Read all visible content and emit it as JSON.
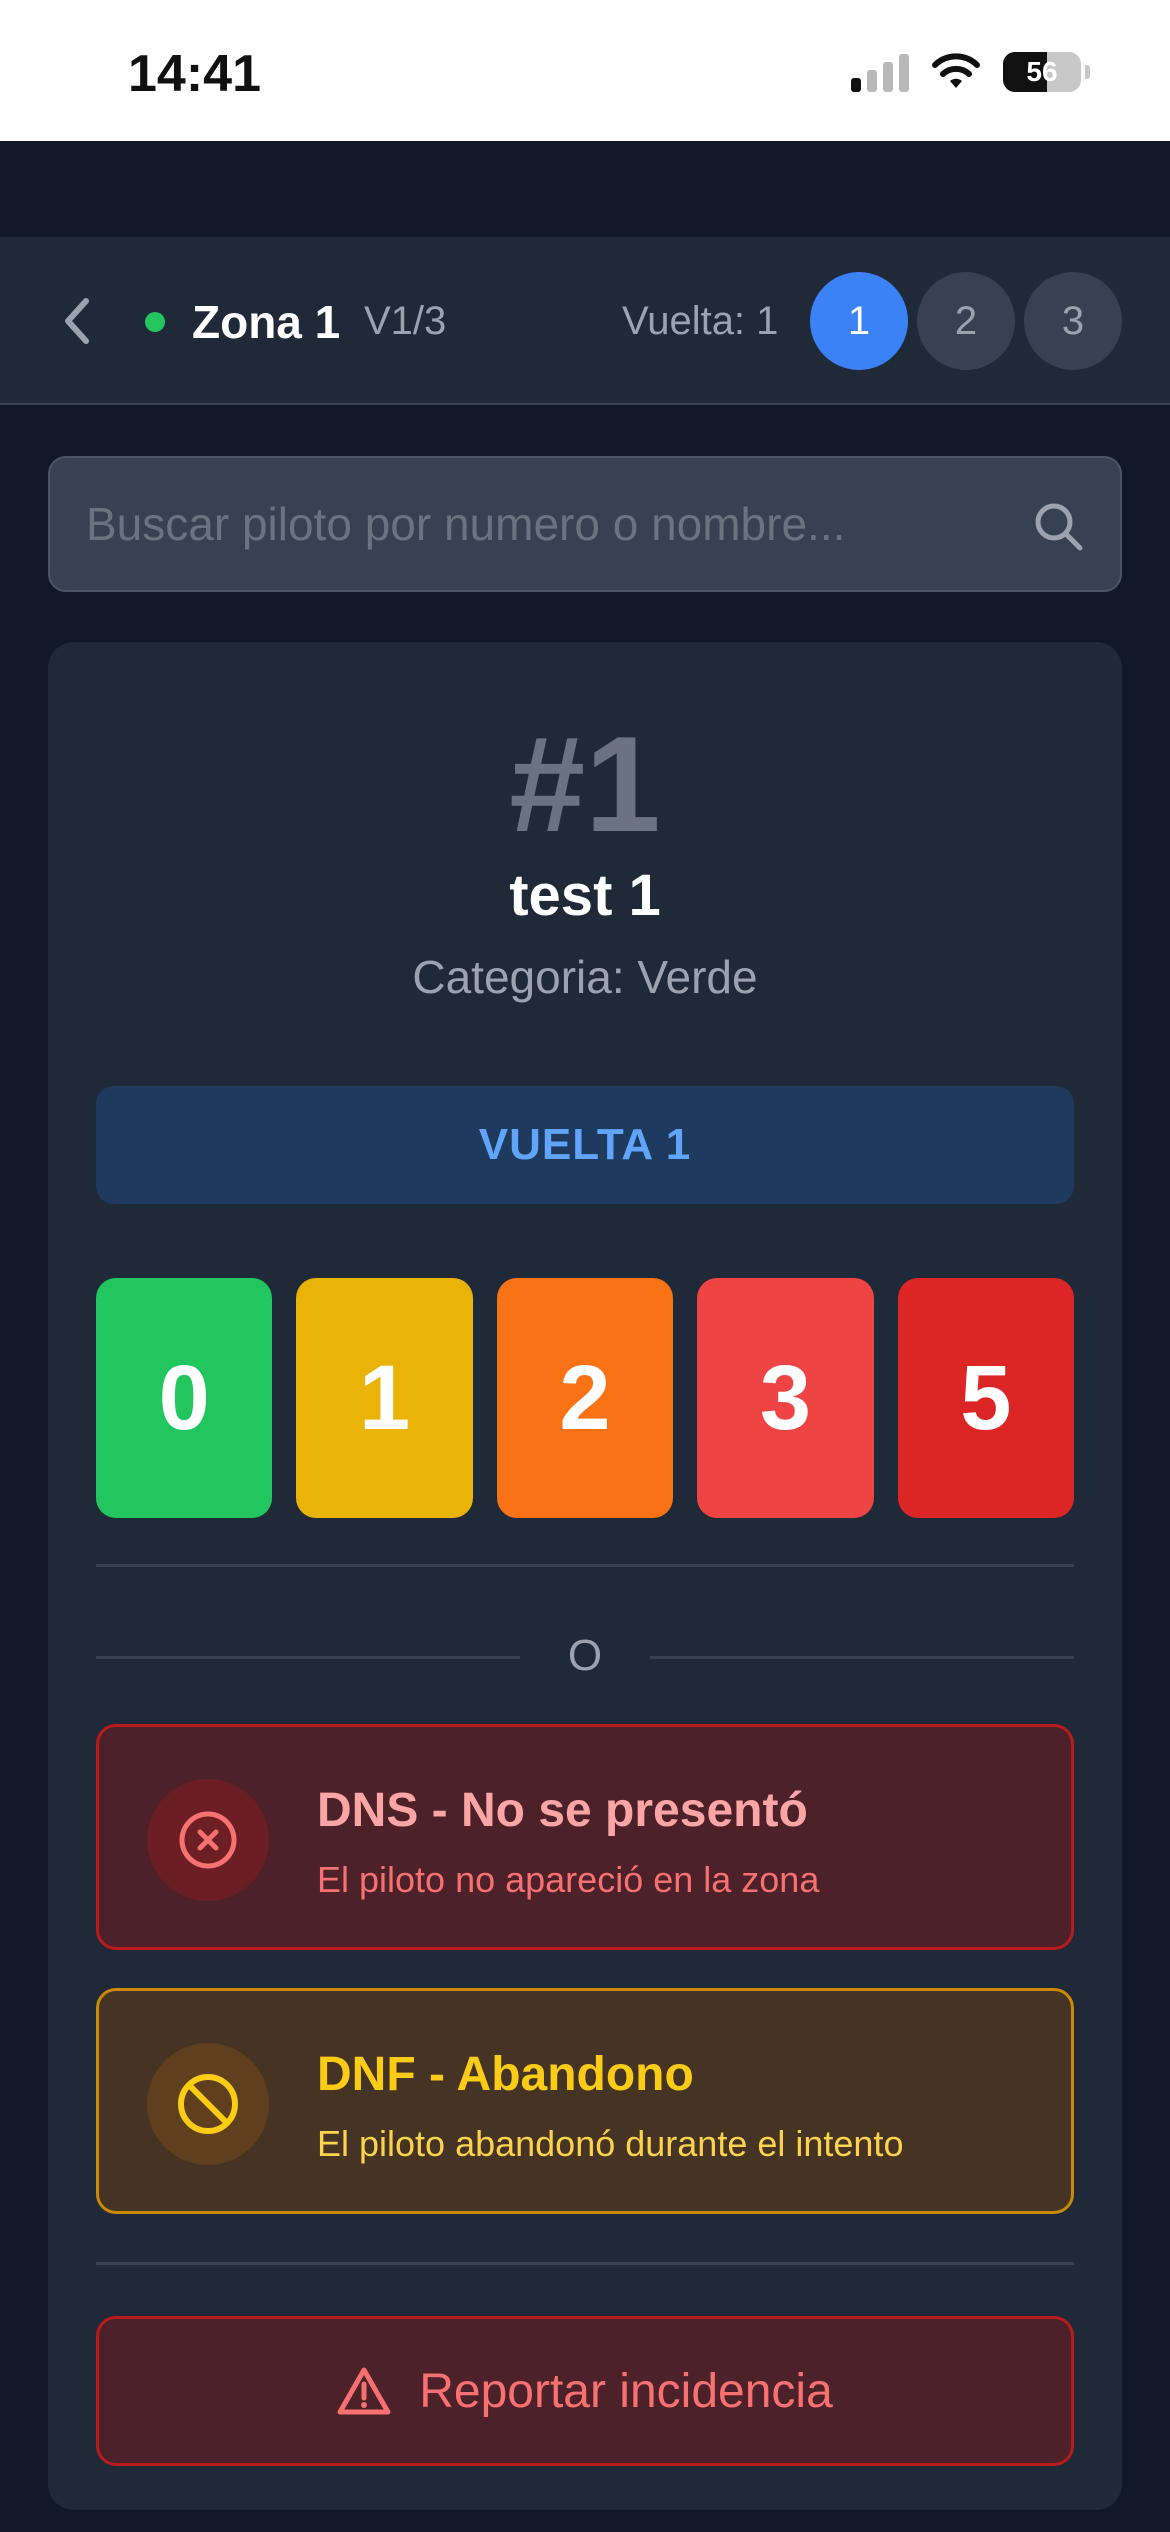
{
  "status_bar": {
    "time": "14:41",
    "battery": "56"
  },
  "header": {
    "zone_name": "Zona 1",
    "zone_version": "V1/3",
    "lap_label": "Vuelta: 1",
    "laps": [
      "1",
      "2",
      "3"
    ],
    "active_lap": "1",
    "status_dot_color": "#22c55e"
  },
  "search": {
    "placeholder": "Buscar piloto por numero o nombre..."
  },
  "pilot": {
    "number": "#1",
    "name": "test 1",
    "category": "Categoria: Verde"
  },
  "lap_banner": "VUELTA 1",
  "scores": [
    {
      "label": "0",
      "color": "#22c55e"
    },
    {
      "label": "1",
      "color": "#eab308"
    },
    {
      "label": "2",
      "color": "#f97316"
    },
    {
      "label": "3",
      "color": "#ef4444"
    },
    {
      "label": "5",
      "color": "#dc2626"
    }
  ],
  "separator_text": "O",
  "dns": {
    "title": "DNS - No se presentó",
    "subtitle": "El piloto no apareció en la zona"
  },
  "dnf": {
    "title": "DNF - Abandono",
    "subtitle": "El piloto abandonó durante el intento"
  },
  "report": {
    "label": "Reportar incidencia"
  }
}
